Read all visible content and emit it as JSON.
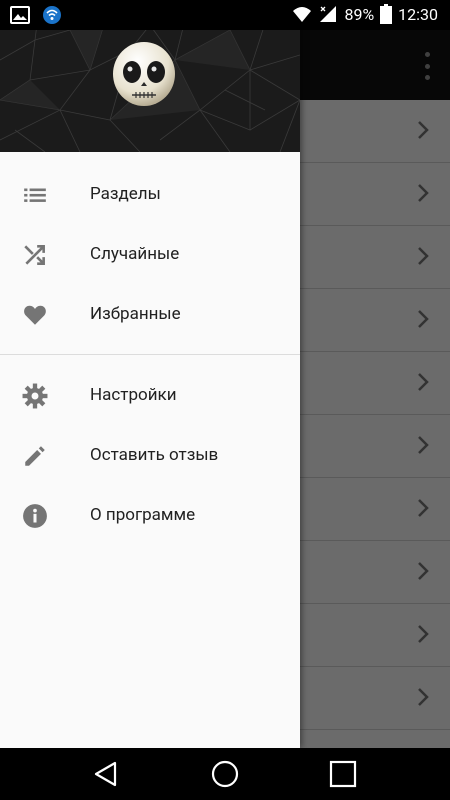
{
  "status_bar": {
    "battery": "89%",
    "time": "12:30"
  },
  "drawer": {
    "items_primary": [
      {
        "label": "Разделы",
        "icon": "list-icon"
      },
      {
        "label": "Случайные",
        "icon": "shuffle-icon"
      },
      {
        "label": "Избранные",
        "icon": "heart-icon"
      }
    ],
    "items_secondary": [
      {
        "label": "Настройки",
        "icon": "gear-icon"
      },
      {
        "label": "Оставить отзыв",
        "icon": "pencil-icon"
      },
      {
        "label": "О программе",
        "icon": "info-icon"
      }
    ]
  },
  "colors": {
    "drawer_bg": "#fafafa",
    "app_bar": "#111111",
    "text": "#212121",
    "icon": "#757575"
  }
}
